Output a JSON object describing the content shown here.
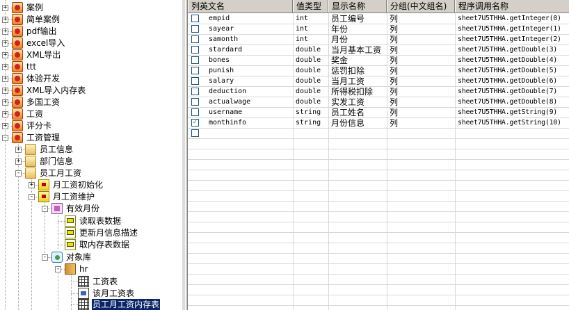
{
  "tree": {
    "nodes": [
      {
        "label": "案例",
        "icon": "report-icon",
        "expander": "+"
      },
      {
        "label": "简单案例",
        "icon": "report-icon",
        "expander": "+"
      },
      {
        "label": "pdf输出",
        "icon": "report-icon",
        "expander": "+"
      },
      {
        "label": "excel导入",
        "icon": "report-icon",
        "expander": "+"
      },
      {
        "label": "XML导出",
        "icon": "report-icon",
        "expander": "+"
      },
      {
        "label": "ttt",
        "icon": "report-icon",
        "expander": "+"
      },
      {
        "label": "体验开发",
        "icon": "report-icon",
        "expander": "+"
      },
      {
        "label": "XML导入内存表",
        "icon": "report-icon",
        "expander": "+"
      },
      {
        "label": "多国工资",
        "icon": "report-icon",
        "expander": "+"
      },
      {
        "label": "工资",
        "icon": "report-icon",
        "expander": "+"
      },
      {
        "label": "评分卡",
        "icon": "report-icon",
        "expander": "+"
      },
      {
        "label": "工资管理",
        "icon": "report-icon",
        "expander": "-"
      },
      {
        "label": "员工信息",
        "icon": "folder-icon",
        "expander": "+"
      },
      {
        "label": "部门信息",
        "icon": "folder-icon",
        "expander": "+"
      },
      {
        "label": "员工月工资",
        "icon": "folder-icon",
        "expander": "-"
      },
      {
        "label": "月工资初始化",
        "icon": "package-icon",
        "expander": "+"
      },
      {
        "label": "月工资维护",
        "icon": "package-icon",
        "expander": "-"
      },
      {
        "label": "有效月份",
        "icon": "month-icon",
        "expander": "-"
      },
      {
        "label": "读取表数据",
        "icon": "action-icon",
        "expander": ""
      },
      {
        "label": "更新月信息描述",
        "icon": "action-icon",
        "expander": ""
      },
      {
        "label": "取内存表数据",
        "icon": "action-icon",
        "expander": ""
      },
      {
        "label": "对象库",
        "icon": "database-icon",
        "expander": "-"
      },
      {
        "label": "hr",
        "icon": "schema-icon",
        "expander": "-"
      },
      {
        "label": "工资表",
        "icon": "table-icon",
        "expander": ""
      },
      {
        "label": "该月工资表",
        "icon": "view-icon",
        "expander": ""
      },
      {
        "label": "员工月工资内存表",
        "icon": "table-icon",
        "expander": ""
      }
    ]
  },
  "grid": {
    "headers": [
      "列英文名",
      "值类型",
      "显示名称",
      "分组(中文组名)",
      "程序调用名称"
    ],
    "rows": [
      {
        "checked": false,
        "name": "empid",
        "type": "int",
        "display": "员工编号",
        "group": "列",
        "call": "sheet7U5THHA.getInteger(0)"
      },
      {
        "checked": false,
        "name": "sayear",
        "type": "int",
        "display": "年份",
        "group": "列",
        "call": "sheet7U5THHA.getInteger(1)"
      },
      {
        "checked": false,
        "name": "samonth",
        "type": "int",
        "display": "月份",
        "group": "列",
        "call": "sheet7U5THHA.getInteger(2)"
      },
      {
        "checked": false,
        "name": "stardard",
        "type": "double",
        "display": "当月基本工资",
        "group": "列",
        "call": "sheet7U5THHA.getDouble(3)"
      },
      {
        "checked": false,
        "name": "bones",
        "type": "double",
        "display": "奖金",
        "group": "列",
        "call": "sheet7U5THHA.getDouble(4)"
      },
      {
        "checked": false,
        "name": "punish",
        "type": "double",
        "display": "惩罚扣除",
        "group": "列",
        "call": "sheet7U5THHA.getDouble(5)"
      },
      {
        "checked": false,
        "name": "salary",
        "type": "double",
        "display": "当月工资",
        "group": "列",
        "call": "sheet7U5THHA.getDouble(6)"
      },
      {
        "checked": false,
        "name": "deduction",
        "type": "double",
        "display": "所得税扣除",
        "group": "列",
        "call": "sheet7U5THHA.getDouble(7)"
      },
      {
        "checked": false,
        "name": "actualwage",
        "type": "double",
        "display": "实发工资",
        "group": "列",
        "call": "sheet7U5THHA.getDouble(8)"
      },
      {
        "checked": false,
        "name": "username",
        "type": "string",
        "display": "员工姓名",
        "group": "列",
        "call": "sheet7U5THHA.getString(9)"
      },
      {
        "checked": true,
        "name": "monthinfo",
        "type": "string",
        "display": "月份信息",
        "group": "列",
        "call": "sheet7U5THHA.getString(10)"
      },
      {
        "checked": false,
        "name": "",
        "type": "",
        "display": "",
        "group": "",
        "call": ""
      }
    ]
  },
  "colors": {
    "selection": "#0a246a",
    "header_bg": "#d4d0c8",
    "check": "#21a121"
  }
}
